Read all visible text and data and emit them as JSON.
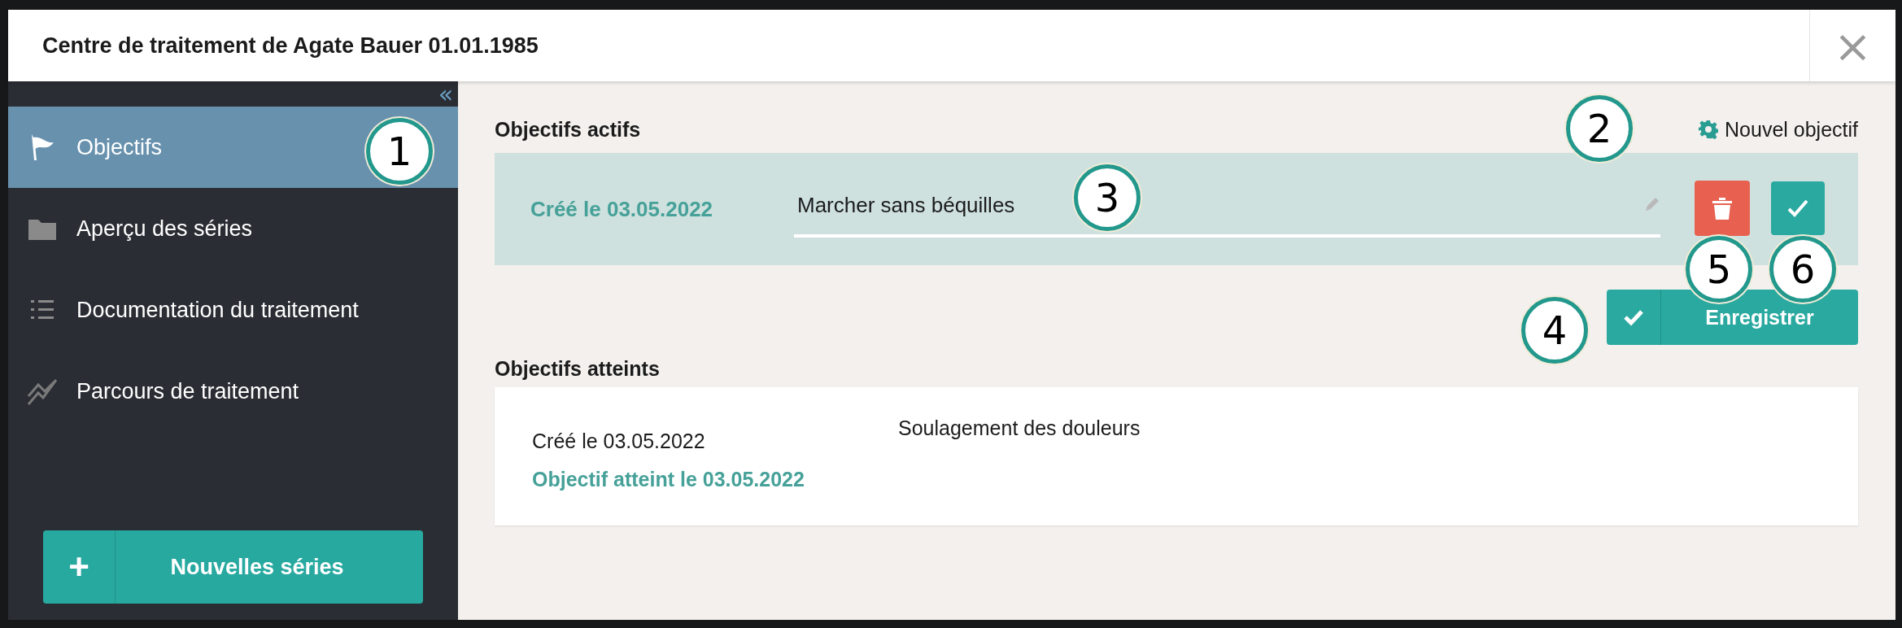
{
  "window": {
    "title": "Centre de traitement de Agate Bauer 01.01.1985",
    "close": "×"
  },
  "sidebar": {
    "collapse": "«",
    "items": [
      {
        "kind": "flag",
        "label": "Objectifs",
        "selected": true
      },
      {
        "kind": "folder",
        "label": "Aperçu des séries",
        "selected": false
      },
      {
        "kind": "list",
        "label": "Documentation du traitement",
        "selected": false
      },
      {
        "kind": "chart",
        "label": "Parcours de traitement",
        "selected": false
      }
    ],
    "new_button": {
      "icon": "+",
      "label": "Nouvelles séries"
    }
  },
  "active": {
    "heading": "Objectifs actifs",
    "new_goal": "Nouvel objectif",
    "goals": [
      {
        "created": "Créé le 03.05.2022",
        "value": "Marcher sans béquilles"
      }
    ],
    "save": "Enregistrer"
  },
  "achieved": {
    "heading": "Objectifs atteints",
    "goals": [
      {
        "created": "Créé le 03.05.2022",
        "reached": "Objectif atteint le 03.05.2022",
        "text": "Soulagement des douleurs"
      }
    ]
  },
  "callouts": [
    "1",
    "2",
    "3",
    "4",
    "5",
    "6"
  ]
}
